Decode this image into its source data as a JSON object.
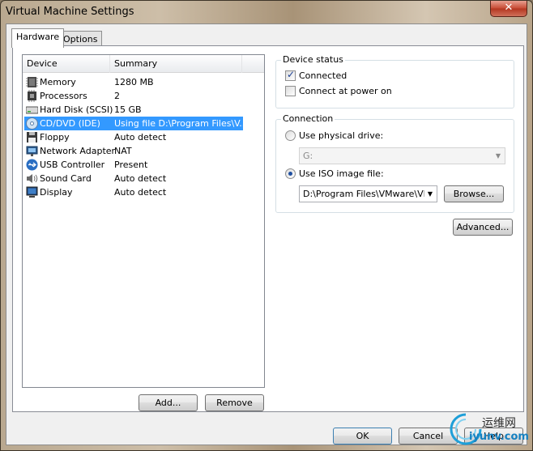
{
  "window": {
    "title": "Virtual Machine Settings",
    "close_glyph": "✕"
  },
  "tabs": [
    {
      "label": "Hardware"
    },
    {
      "label": "Options"
    }
  ],
  "device_list": {
    "columns": {
      "device": "Device",
      "summary": "Summary"
    },
    "rows": [
      {
        "icon": "memory-icon",
        "device": "Memory",
        "summary": "1280 MB"
      },
      {
        "icon": "processor-icon",
        "device": "Processors",
        "summary": "2"
      },
      {
        "icon": "hard-disk-icon",
        "device": "Hard Disk (SCSI)",
        "summary": "15 GB"
      },
      {
        "icon": "cd-dvd-icon",
        "device": "CD/DVD (IDE)",
        "summary": "Using file D:\\Program Files\\V..."
      },
      {
        "icon": "floppy-icon",
        "device": "Floppy",
        "summary": "Auto detect"
      },
      {
        "icon": "network-adapter-icon",
        "device": "Network Adapter",
        "summary": "NAT"
      },
      {
        "icon": "usb-icon",
        "device": "USB Controller",
        "summary": "Present"
      },
      {
        "icon": "sound-card-icon",
        "device": "Sound Card",
        "summary": "Auto detect"
      },
      {
        "icon": "display-icon",
        "device": "Display",
        "summary": "Auto detect"
      }
    ],
    "selected_device": "CD/DVD (IDE)"
  },
  "buttons": {
    "add": "Add...",
    "remove": "Remove",
    "browse": "Browse...",
    "advanced": "Advanced...",
    "ok": "OK",
    "cancel": "Cancel",
    "help": "Help"
  },
  "device_status": {
    "label": "Device status",
    "connected": {
      "label": "Connected",
      "checked": true
    },
    "connect_at_power_on": {
      "label": "Connect at power on",
      "checked": false
    }
  },
  "connection": {
    "label": "Connection",
    "physical_drive": {
      "label": "Use physical drive:",
      "selected": false,
      "drive_value": "G:"
    },
    "iso_image": {
      "label": "Use ISO image file:",
      "selected": true,
      "path_value": "D:\\Program Files\\VMware\\VMw"
    }
  },
  "watermark": {
    "line1": "运维网",
    "line2": "iyunv.com"
  },
  "colors": {
    "selection": "#3399ff",
    "default_button_border": "#3c7fb1",
    "close_button": "#c64a33"
  }
}
